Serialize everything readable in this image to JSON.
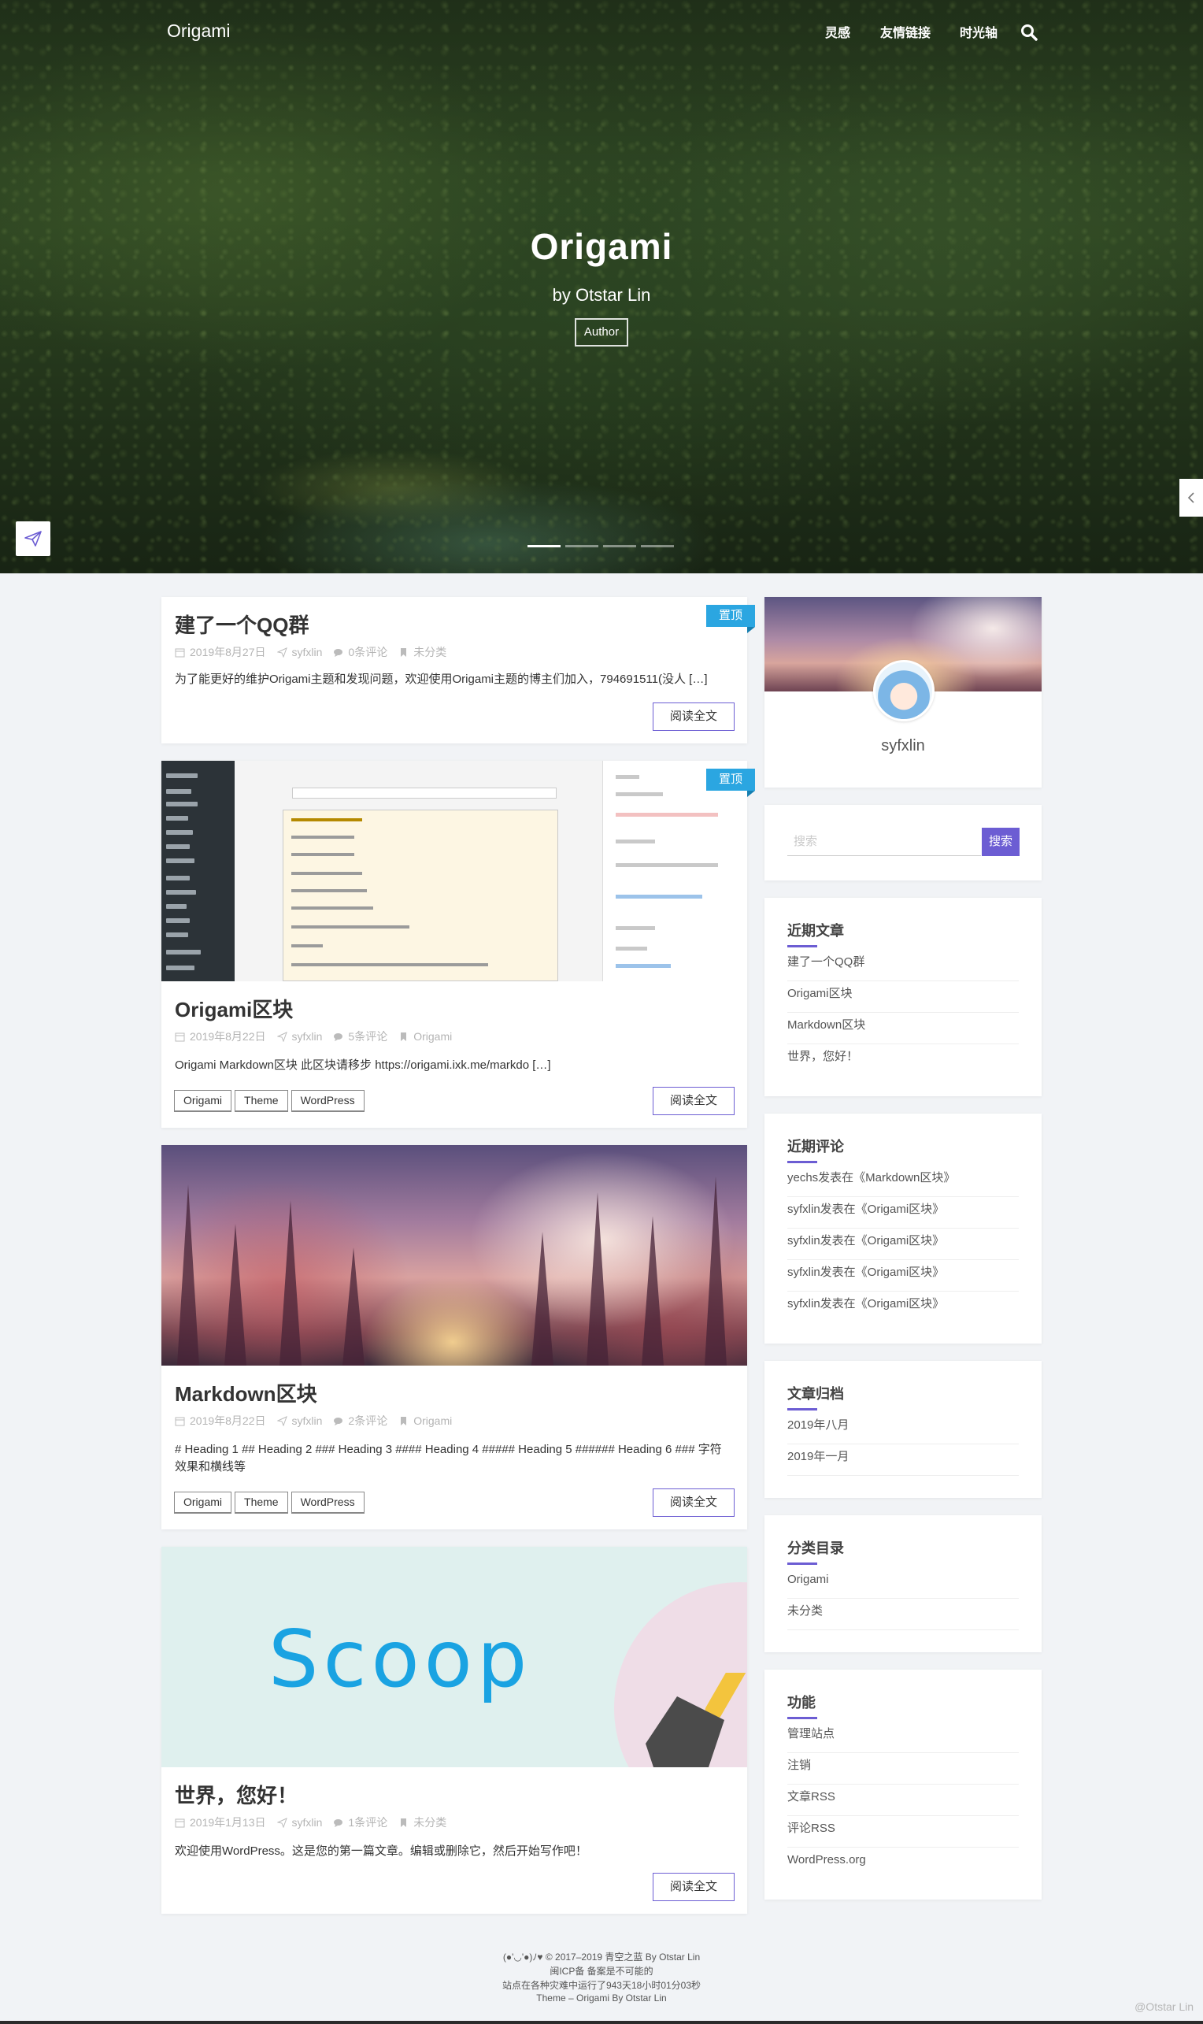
{
  "site": {
    "logo": "Origami"
  },
  "nav": {
    "items": [
      "灵感",
      "友情链接",
      "时光轴"
    ]
  },
  "hero": {
    "title": "Origami",
    "subtitle": "by Otstar Lin",
    "badge": "Author",
    "slides": 4,
    "active_slide": 0
  },
  "posts": [
    {
      "title": "建了一个QQ群",
      "date": "2019年8月27日",
      "author": "syfxlin",
      "comments": "0条评论",
      "category": "未分类",
      "excerpt": "为了能更好的维护Origami主题和发现问题，欢迎使用Origami主题的博主们加入，794691511(没人 […]",
      "read_more": "阅读全文",
      "sticky": "置顶"
    },
    {
      "title": "Origami区块",
      "date": "2019年8月22日",
      "author": "syfxlin",
      "comments": "5条评论",
      "category": "Origami",
      "excerpt": "Origami Markdown区块 此区块请移步 https://origami.ixk.me/markdo […]",
      "tags": [
        "Origami",
        "Theme",
        "WordPress"
      ],
      "read_more": "阅读全文",
      "sticky": "置顶"
    },
    {
      "title": "Markdown区块",
      "date": "2019年8月22日",
      "author": "syfxlin",
      "comments": "2条评论",
      "category": "Origami",
      "excerpt": "# Heading 1 ## Heading 2 ### Heading 3 #### Heading 4 ##### Heading 5 ###### Heading 6 ### 字符效果和横线等",
      "tags": [
        "Origami",
        "Theme",
        "WordPress"
      ],
      "read_more": "阅读全文"
    },
    {
      "title": "世界，您好！",
      "date": "2019年1月13日",
      "author": "syfxlin",
      "comments": "1条评论",
      "category": "未分类",
      "excerpt": "欢迎使用WordPress。这是您的第一篇文章。编辑或删除它，然后开始写作吧！",
      "read_more": "阅读全文",
      "thumb_text": "Scoop"
    }
  ],
  "sidebar": {
    "profile": {
      "name": "syfxlin"
    },
    "search": {
      "placeholder": "搜索",
      "button": "搜索"
    },
    "recent_posts": {
      "title": "近期文章",
      "items": [
        "建了一个QQ群",
        "Origami区块",
        "Markdown区块",
        "世界，您好！"
      ]
    },
    "recent_comments": {
      "title": "近期评论",
      "items": [
        "yechs发表在《Markdown区块》",
        "syfxlin发表在《Origami区块》",
        "syfxlin发表在《Origami区块》",
        "syfxlin发表在《Origami区块》",
        "syfxlin发表在《Origami区块》"
      ]
    },
    "archives": {
      "title": "文章归档",
      "items": [
        "2019年八月",
        "2019年一月"
      ]
    },
    "categories": {
      "title": "分类目录",
      "items": [
        "Origami",
        "未分类"
      ]
    },
    "meta": {
      "title": "功能",
      "items": [
        "管理站点",
        "注销",
        "文章RSS",
        "评论RSS",
        "WordPress.org"
      ]
    }
  },
  "footer": {
    "line1": "(●'◡'●)ﾉ♥  © 2017–2019 青空之蓝 By Otstar Lin",
    "line2": "闽ICP备 备案是不可能的",
    "line3": "站点在各种灾难中运行了943天18小时01分03秒",
    "line4": "Theme – Origami By Otstar Lin",
    "copyright": "@Otstar Lin"
  },
  "colors": {
    "accent": "#6c5dd3",
    "sticky": "#2ba6e1",
    "background": "#f1f3f6",
    "scoop": "#1aa3e2"
  }
}
